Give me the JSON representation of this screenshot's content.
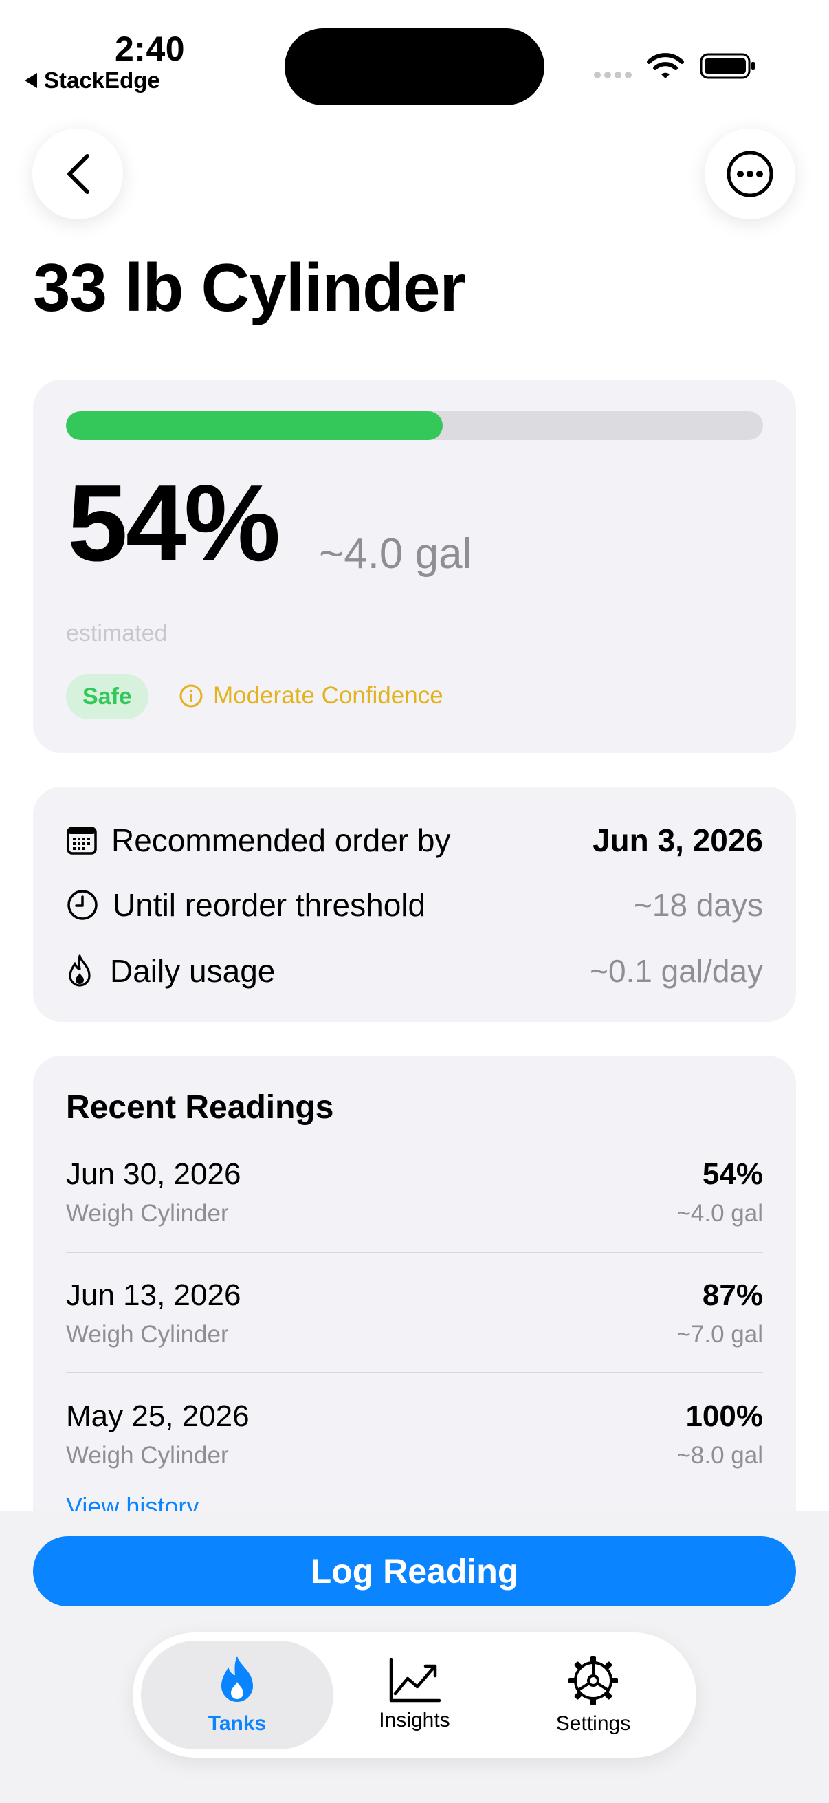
{
  "status_bar": {
    "time": "2:40",
    "back_app": "StackEdge"
  },
  "header": {
    "title": "33 lb Cylinder"
  },
  "level": {
    "fill_percent": 54,
    "percent_text": "54%",
    "gallons_text": "~4.0 gal",
    "estimate_label": "estimated",
    "status_badge": "Safe",
    "confidence": "Moderate Confidence",
    "colors": {
      "fill": "#34c759",
      "badge": "#34c759",
      "confidence": "#e3b21d"
    }
  },
  "info": {
    "rows": [
      {
        "icon": "calendar-icon",
        "label": "Recommended order by",
        "value": "Jun 3, 2026"
      },
      {
        "icon": "clock-icon",
        "label": "Until reorder threshold",
        "value": "~18 days"
      },
      {
        "icon": "flame-icon",
        "label": "Daily usage",
        "value": "~0.1 gal/day"
      }
    ]
  },
  "readings": {
    "title": "Recent Readings",
    "items": [
      {
        "date": "Jun 30, 2026",
        "method": "Weigh Cylinder",
        "percent": "54%",
        "gallons": "~4.0 gal"
      },
      {
        "date": "Jun 13, 2026",
        "method": "Weigh Cylinder",
        "percent": "87%",
        "gallons": "~7.0 gal"
      },
      {
        "date": "May 25, 2026",
        "method": "Weigh Cylinder",
        "percent": "100%",
        "gallons": "~8.0 gal"
      }
    ],
    "view_history": "View history"
  },
  "actions": {
    "log_reading": "Log Reading"
  },
  "tabs": [
    {
      "label": "Tanks",
      "icon": "flame-icon",
      "active": true
    },
    {
      "label": "Insights",
      "icon": "chart-icon",
      "active": false
    },
    {
      "label": "Settings",
      "icon": "gear-icon",
      "active": false
    }
  ],
  "accent_color": "#0a84ff"
}
